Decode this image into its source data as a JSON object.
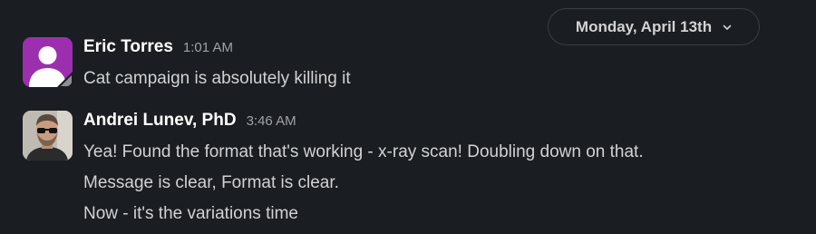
{
  "date_divider": {
    "label": "Monday, April 13th",
    "icon": "chevron-down-icon"
  },
  "messages": [
    {
      "author": "Eric Torres",
      "time": "1:01 AM",
      "avatar": "default-user-avatar",
      "lines": [
        "Cat campaign is absolutely killing it"
      ]
    },
    {
      "author": "Andrei Lunev, PhD",
      "time": "3:46 AM",
      "avatar": "photo-avatar",
      "lines": [
        "Yea! Found the format that's working - x-ray scan! Doubling down on that.",
        "Message is clear, Format is clear.",
        "Now - it's the variations time"
      ]
    }
  ],
  "colors": {
    "background": "#1a1d21",
    "default_avatar": "#9b2fae",
    "text": "#d1d2d3",
    "name": "#ffffff",
    "timestamp": "#a0a2a6"
  }
}
